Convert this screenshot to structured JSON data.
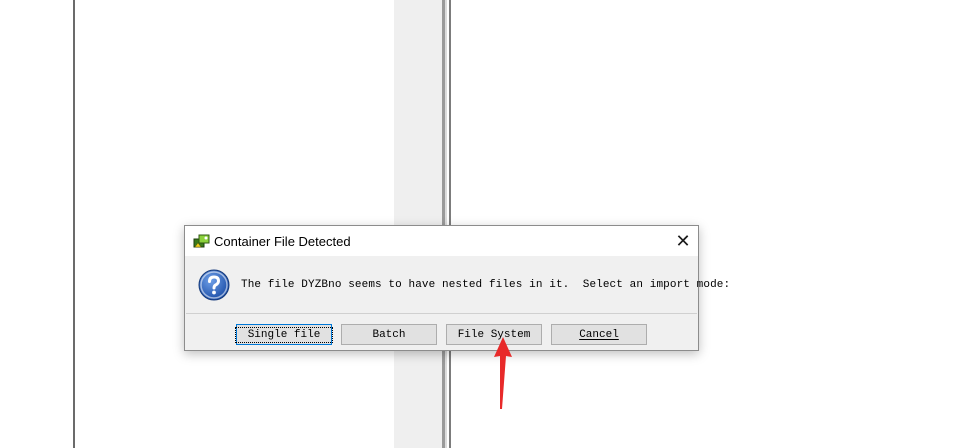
{
  "dialog": {
    "title": "Container File Detected",
    "close_symbol": "✕",
    "message": "The file DYZBno seems to have nested files in it.  Select an import mode:",
    "icons": {
      "app": "app-icon",
      "question": "question-icon"
    }
  },
  "buttons": {
    "single_file": "Single file",
    "batch": "Batch",
    "file_system": "File System",
    "cancel": "Cancel"
  },
  "annotation": {
    "arrow_color": "#e82a2a"
  }
}
